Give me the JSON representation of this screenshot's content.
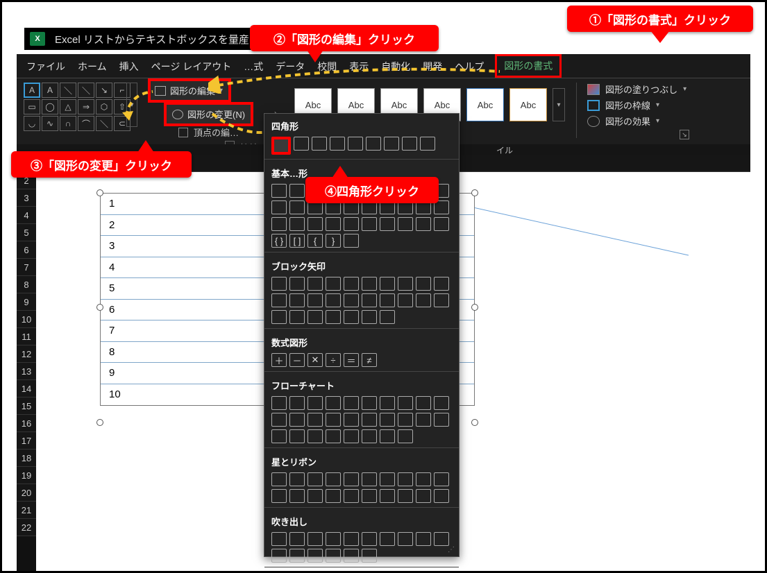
{
  "titlebar": {
    "app_icon": "X",
    "title": "Excel リストからテキストボックスを量産する方法"
  },
  "tabs": {
    "file": "ファイル",
    "home": "ホーム",
    "insert": "挿入",
    "layout": "ページ レイアウト",
    "formula": "…式",
    "data": "データ",
    "review": "校閲",
    "view": "表示",
    "auto": "自動化",
    "dev": "開発",
    "help": "ヘルプ",
    "format": "図形の書式"
  },
  "edit_shape": {
    "label": "図形の編集",
    "change": "図形の変更(N)",
    "vertex": "頂点の編…",
    "connect": "接続(T)"
  },
  "style_sample": "Abc",
  "fmt_list": {
    "fill": "図形の塗りつぶし",
    "outline": "図形の枠線",
    "effect": "図形の効果"
  },
  "subbar_hint": "イル",
  "picker": {
    "h_rect": "四角形",
    "h_basic": "基本…形",
    "h_arrow": "ブロック矢印",
    "h_math": "数式図形",
    "h_flow": "フローチャート",
    "h_star": "星とリボン",
    "h_call": "吹き出し"
  },
  "callouts": {
    "c1": "①「図形の書式」クリック",
    "c2": "②「図形の編集」クリック",
    "c3": "③「図形の変更」クリック",
    "c4": "④四角形クリック"
  },
  "row_headers": [
    "2",
    "3",
    "4",
    "5",
    "6",
    "7",
    "8",
    "9",
    "10",
    "11",
    "12",
    "13",
    "14",
    "15",
    "16",
    "17",
    "18",
    "19",
    "20",
    "21",
    "22"
  ],
  "textbox_lines": [
    "1",
    "2",
    "3",
    "4",
    "5",
    "6",
    "7",
    "8",
    "9",
    "10"
  ]
}
